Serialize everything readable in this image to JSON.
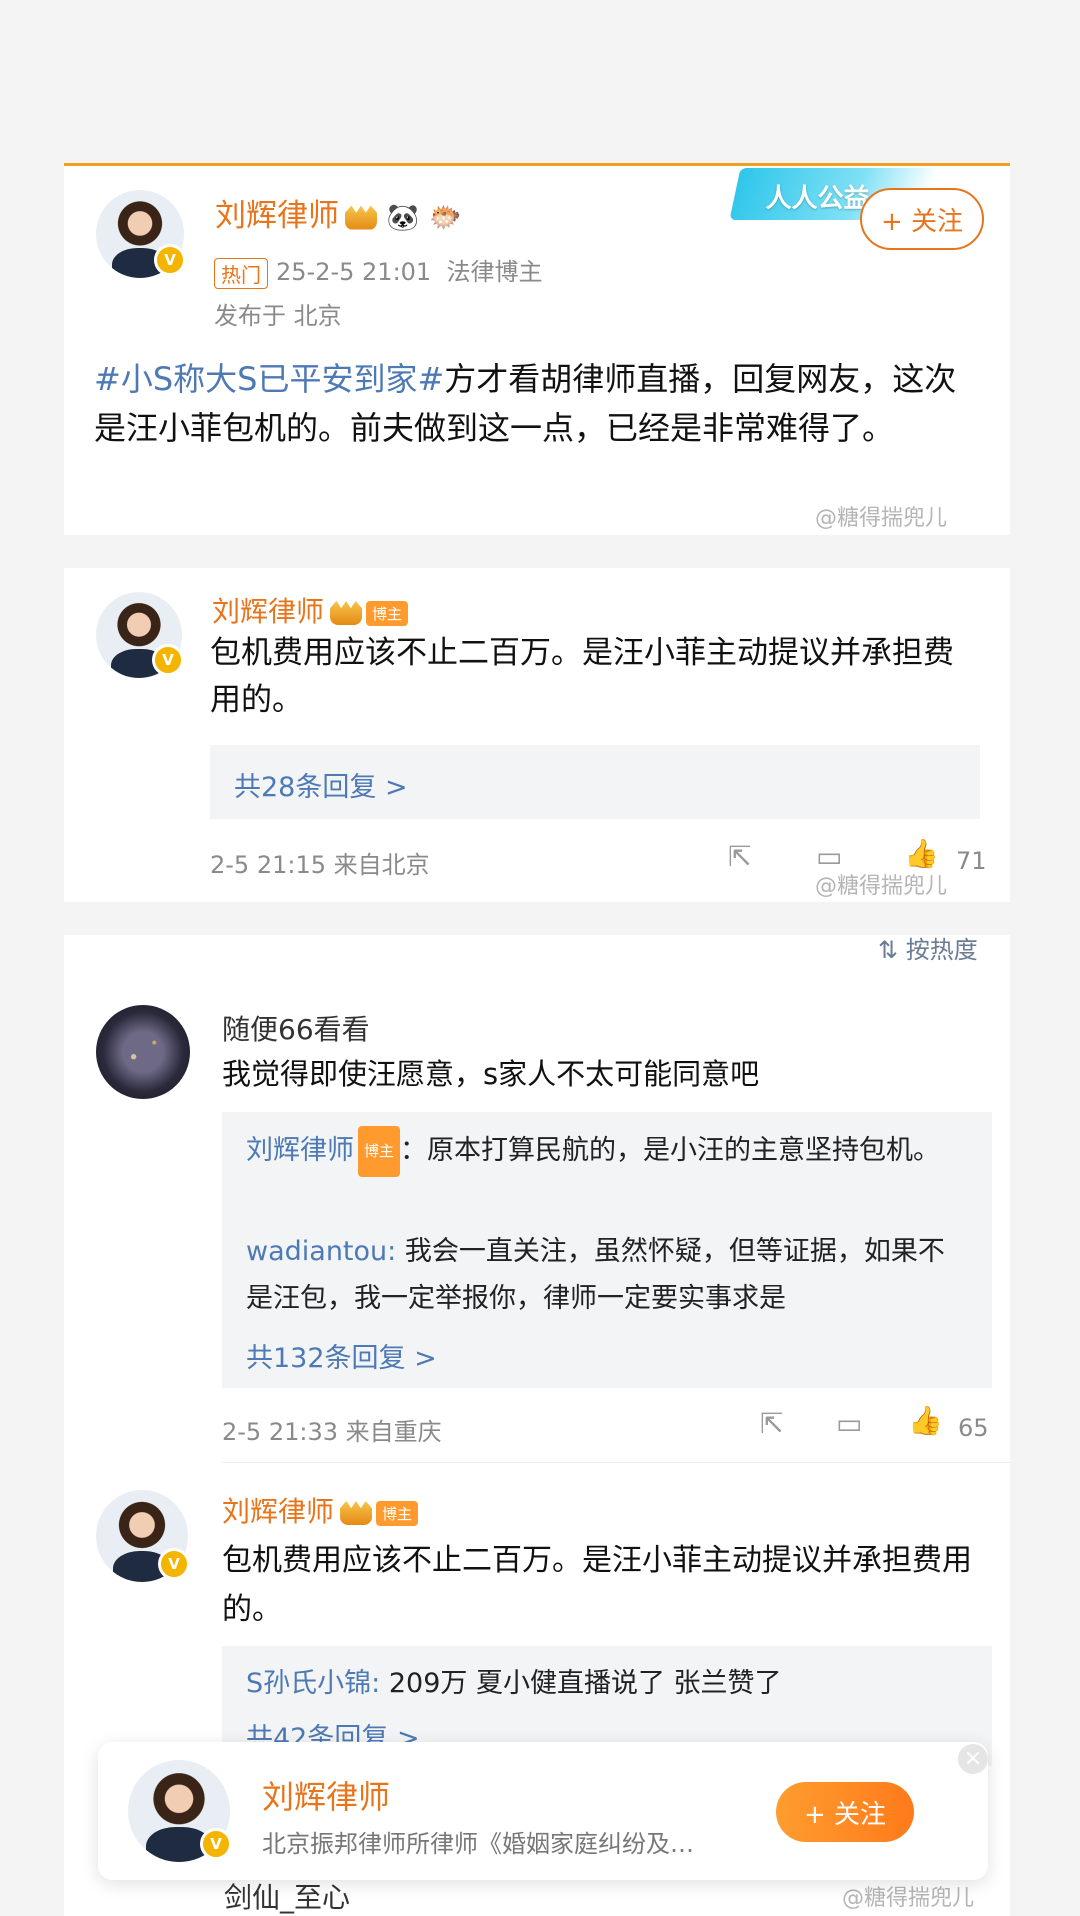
{
  "post": {
    "author": "刘辉律师",
    "hot_tag": "热门",
    "datetime": "25-2-5 21:01",
    "category": "法律博主",
    "location": "发布于 北京",
    "topic": "#小S称大S已平安到家#",
    "body": "方才看胡律师直播，回复网友，这次是汪小菲包机的。前夫做到这一点，已经是非常难得了。",
    "follow_label": "+ 关注",
    "banner_text": "人人公益",
    "watermark": "@糖得揣兜儿"
  },
  "comment1": {
    "author": "刘辉律师",
    "badge": "博主",
    "text": "包机费用应该不止二百万。是汪小菲主动提议并承担费用的。",
    "replies_link": "共28条回复 >",
    "time_location": "2-5 21:15  来自北京",
    "likes": "71",
    "watermark": "@糖得揣兜儿"
  },
  "sort_label": "按热度",
  "comment2": {
    "author": "随便66看看",
    "text": "我觉得即使汪愿意，s家人不太可能同意吧",
    "reply1_who": "刘辉律师",
    "reply1_badge": "博主",
    "reply1_text": "：原本打算民航的，是小汪的主意坚持包机。",
    "reply2_who": "wadiantou:",
    "reply2_text": " 我会一直关注，虽然怀疑，但等证据，如果不是汪包，我一定举报你，律师一定要实事求是",
    "replies_link": "共132条回复 >",
    "time_location": "2-5 21:33  来自重庆",
    "likes": "65"
  },
  "comment3": {
    "author": "刘辉律师",
    "badge": "博主",
    "text": "包机费用应该不止二百万。是汪小菲主动提议并承担费用的。",
    "reply1_who": "S孙氏小锦:",
    "reply1_text": " 209万 夏小健直播说了 张兰赞了",
    "replies_link": "共42条回复 >"
  },
  "popup": {
    "name": "刘辉律师",
    "desc": "北京振邦律师所律师《婚姻家庭纠纷及…",
    "follow_label": "+ 关注"
  },
  "next_commenter": "剑仙_至心",
  "bottom_watermark": "@糖得揣兜儿",
  "colors": {
    "accent": "#e8741c",
    "link": "#4d79b4",
    "background": "#f4f4f4"
  }
}
